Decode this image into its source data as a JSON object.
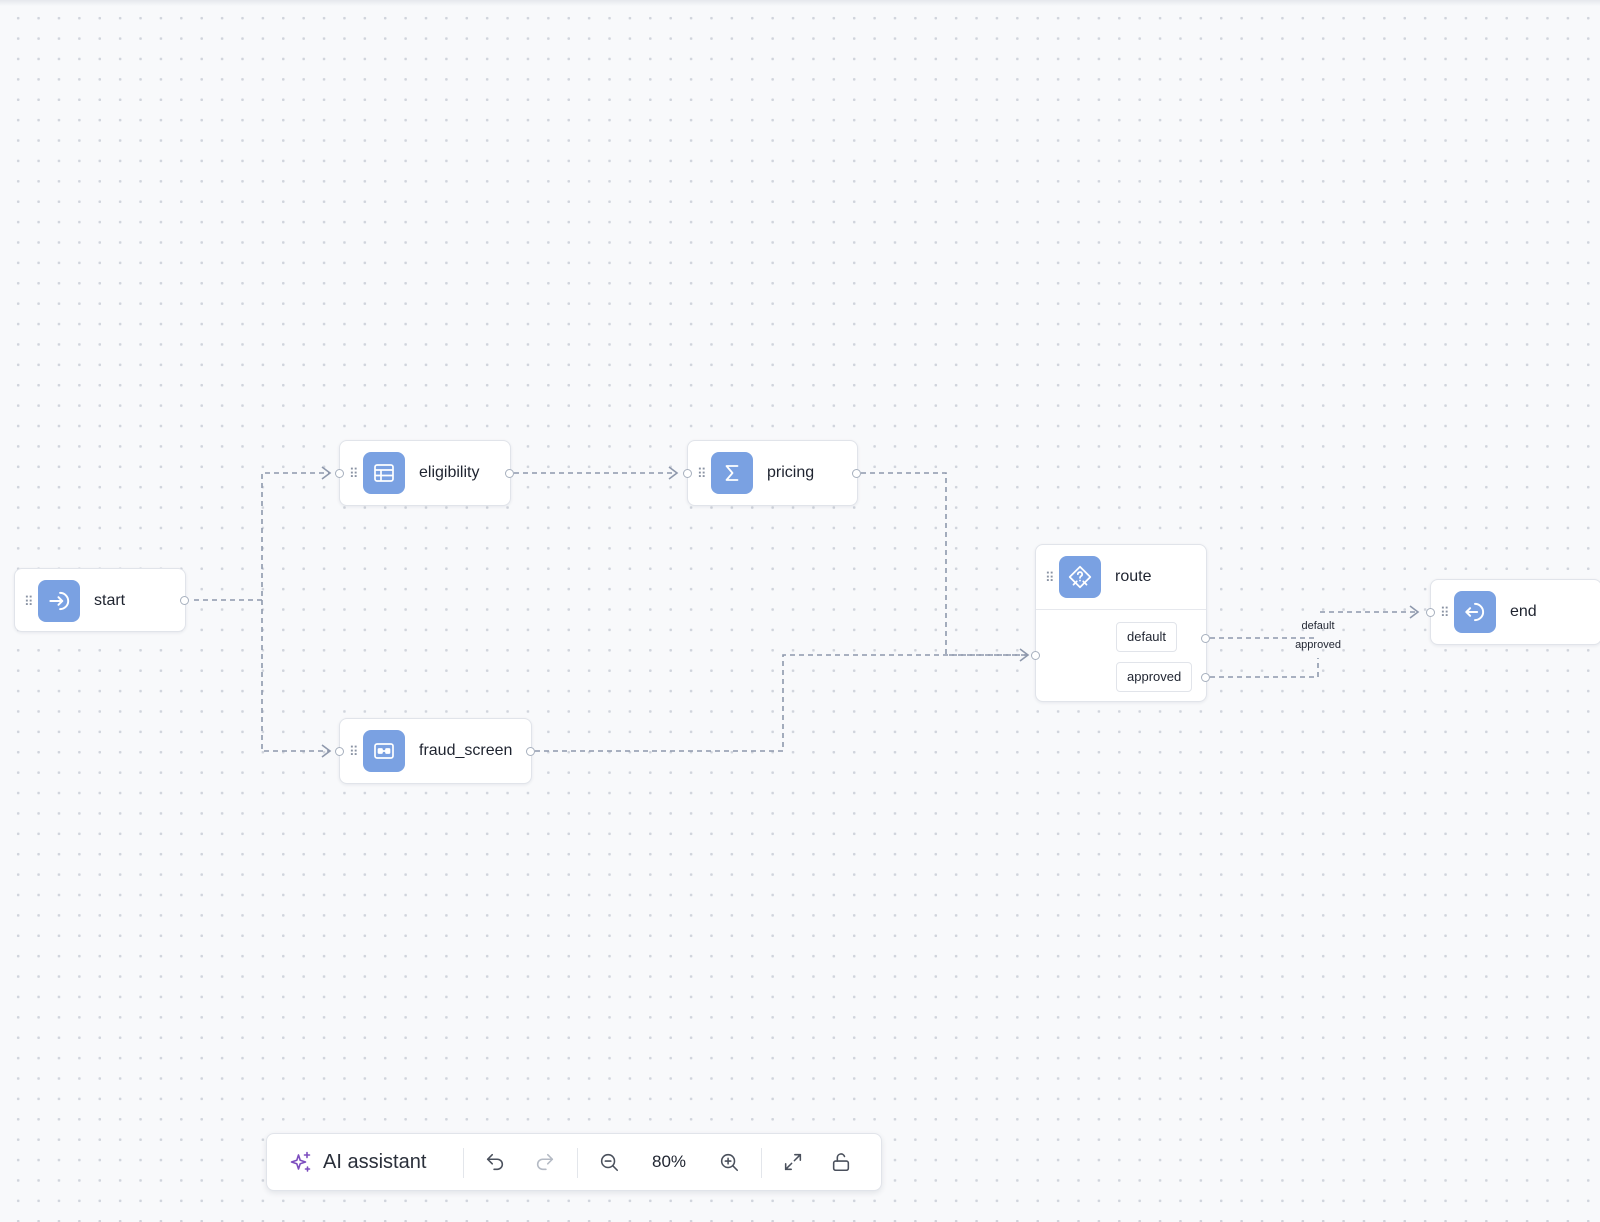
{
  "nodes": {
    "start": {
      "label": "start",
      "icon": "arrow-into-circle-icon"
    },
    "eligibility": {
      "label": "eligibility",
      "icon": "table-icon"
    },
    "pricing": {
      "label": "pricing",
      "icon": "sigma-icon"
    },
    "fraud_screen": {
      "label": "fraud_screen",
      "icon": "transform-icon"
    },
    "route": {
      "label": "route",
      "icon": "decision-icon",
      "branches": [
        "default",
        "approved"
      ]
    },
    "end": {
      "label": "end",
      "icon": "arrow-out-circle-icon"
    }
  },
  "edges": {
    "labels": [
      "default",
      "approved"
    ]
  },
  "toolbar": {
    "ai_label": "AI assistant",
    "zoom": "80%",
    "buttons": [
      "undo-icon",
      "redo-icon",
      "zoom-out-icon",
      "zoom-in-icon",
      "fit-view-icon",
      "unlock-icon"
    ]
  },
  "colors": {
    "node_icon_bg": "#7aa1e2",
    "edge": "#8e98ac",
    "ai_accent": "#7c4dbe",
    "canvas_bg": "#f8f9fb"
  }
}
